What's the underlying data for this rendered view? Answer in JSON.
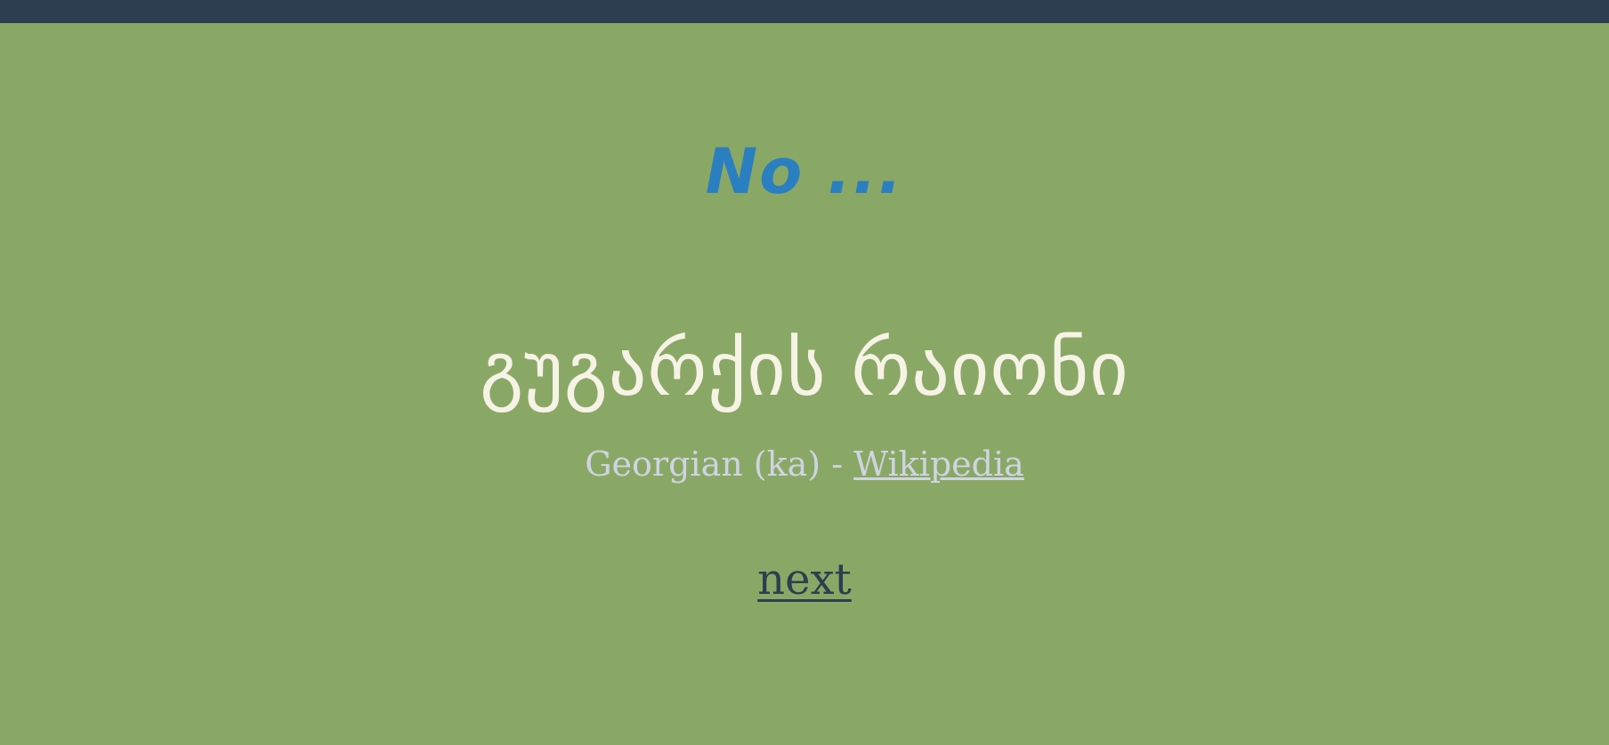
{
  "colors": {
    "background": "#8aa865",
    "top_bar": "#2c3e50",
    "heading": "#2a7fc0",
    "phrase": "#f6f3e6",
    "source_text": "#cfd4e2",
    "next_link": "#2c3e50"
  },
  "heading": {
    "text": "No ..."
  },
  "phrase": {
    "text": "გუგარქის რაიონი"
  },
  "source": {
    "language": "Georgian (ka)",
    "separator": " - ",
    "link_label": "Wikipedia"
  },
  "navigation": {
    "next_label": "next"
  }
}
